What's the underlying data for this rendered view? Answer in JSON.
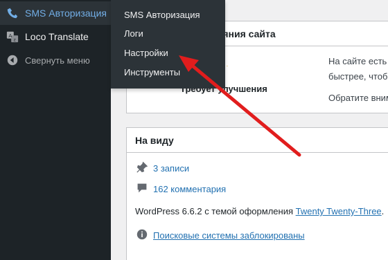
{
  "sidebar": {
    "items": [
      {
        "label": "SMS Авторизация",
        "icon": "phone-icon"
      },
      {
        "label": "Loco Translate",
        "icon": "translate-icon"
      },
      {
        "label": "Свернуть меню",
        "icon": "collapse-menu-icon"
      }
    ]
  },
  "flyout": {
    "items": [
      "SMS Авторизация",
      "Логи",
      "Настройки",
      "Инструменты"
    ]
  },
  "site_health": {
    "title_partial": "ояния сайта",
    "status": "Требует улучшения",
    "text_line1": "На сайте есть в",
    "text_line2": "быстрее, чтобы",
    "text_line3": "Обратите внима"
  },
  "at_a_glance": {
    "title": "На виду",
    "posts": "3 записи",
    "comments": "162 комментария",
    "wp_text": "WordPress 6.6.2 с темой оформления ",
    "theme": "Twenty Twenty-Three",
    "theme_suffix": ".",
    "search_blocked": "Поисковые системы заблокированы"
  },
  "colors": {
    "accent": "#72aee6",
    "link": "#2271b1",
    "arrow": "#e11d1d"
  }
}
